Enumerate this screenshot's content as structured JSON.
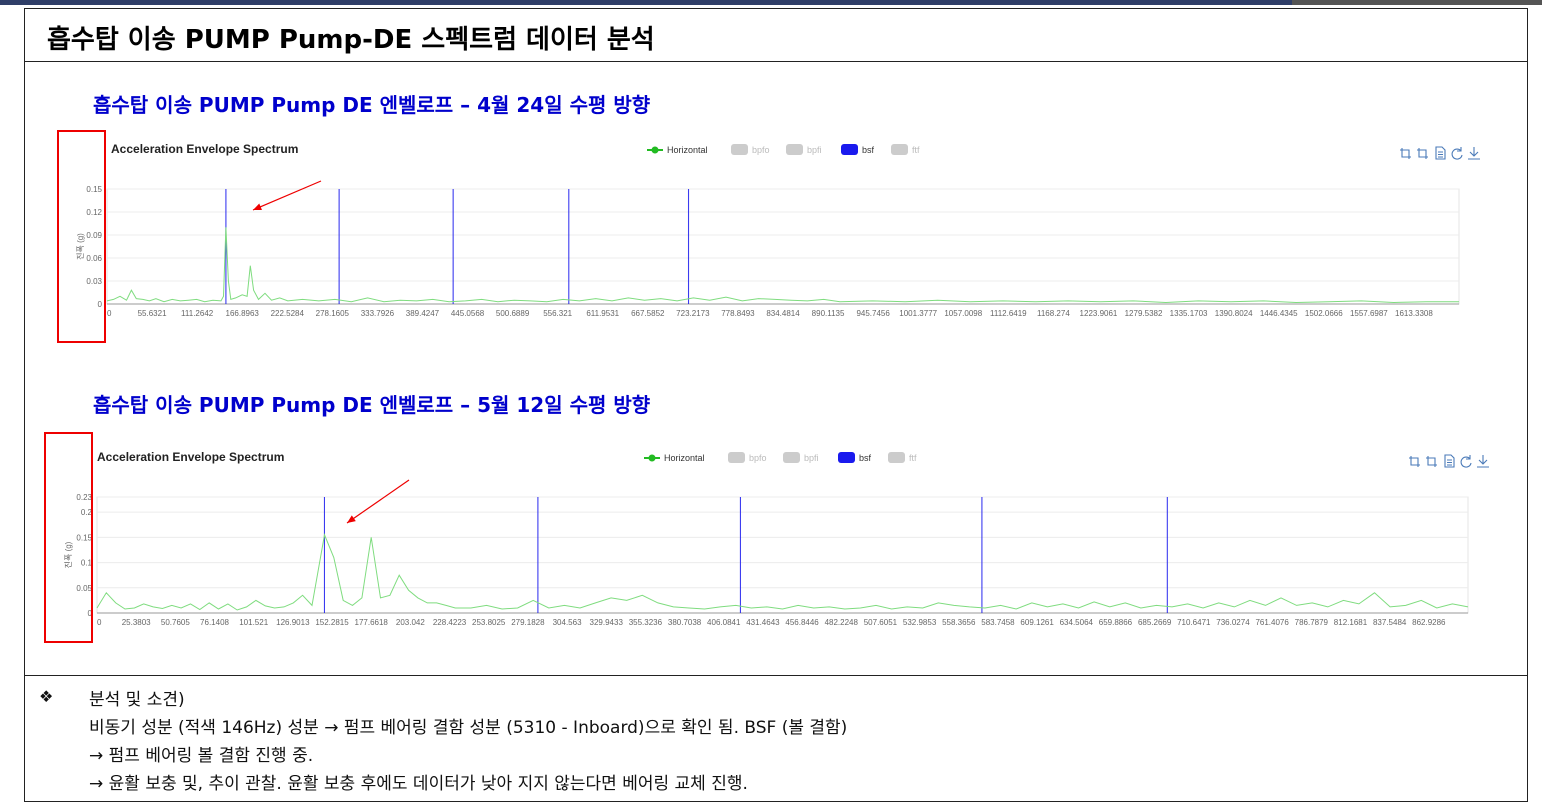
{
  "slide": {
    "title": "흡수탑 이송 PUMP Pump-DE 스펙트럼 데이터 분석"
  },
  "section1": {
    "subtitle": "흡수탑 이송 PUMP Pump DE 엔벨로프 – 4월 24일 수평 방향"
  },
  "section2": {
    "subtitle": "흡수탑 이송 PUMP Pump DE 엔벨로프 – 5월 12일 수평 방향"
  },
  "toolbar_icons": [
    "zoom-icon",
    "zoom-reset-icon",
    "data-view-icon",
    "refresh-icon",
    "download-icon"
  ],
  "colors": {
    "subtitle": "#0000cc",
    "series": "#52c41a",
    "bsf": "#1a1aee",
    "highlight_box": "#ee0000",
    "arrow": "#ee0000"
  },
  "notes": {
    "bullet": "❖",
    "heading": "분석 및 소견)",
    "lines": [
      "비동기 성분 (적색 146Hz) 성분 → 펌프 베어링 결함 성분 (5310 - Inboard)으로 확인 됨. BSF (볼 결함)",
      "→ 펌프 베어링 볼 결함 진행 중.",
      "→ 윤활 보충 및, 추이 관찰.  윤활 보충 후에도 데이터가 낮아 지지 않는다면 베어링 교체 진행."
    ]
  },
  "chart_data": [
    {
      "type": "line",
      "title": "Acceleration Envelope Spectrum",
      "ylabel": "진폭 (g)",
      "ylim": [
        0,
        0.15
      ],
      "yticks": [
        "0",
        "0.03",
        "0.06",
        "0.09",
        "0.12",
        "0.15"
      ],
      "xlim": [
        0,
        1660
      ],
      "xticks": [
        "0",
        "55.6321",
        "111.2642",
        "166.8963",
        "222.5284",
        "278.1605",
        "333.7926",
        "389.4247",
        "445.0568",
        "500.6889",
        "556.321",
        "611.9531",
        "667.5852",
        "723.2173",
        "778.8493",
        "834.4814",
        "890.1135",
        "945.7456",
        "1001.3777",
        "1057.0098",
        "1112.6419",
        "1168.274",
        "1223.9061",
        "1279.5382",
        "1335.1703",
        "1390.8024",
        "1446.4345",
        "1502.0666",
        "1557.6987",
        "1613.3308"
      ],
      "legend": [
        "Horizontal",
        "bpfo",
        "bpfi",
        "bsf",
        "ftf"
      ],
      "legend_active": [
        true,
        false,
        false,
        true,
        false
      ],
      "bsf_markers": [
        146,
        285,
        425,
        567,
        714
      ],
      "series": [
        {
          "name": "Horizontal",
          "x": [
            0,
            8,
            16,
            24,
            30,
            36,
            44,
            52,
            60,
            70,
            80,
            90,
            100,
            110,
            120,
            130,
            140,
            143,
            146,
            149,
            152,
            158,
            166,
            172,
            176,
            180,
            186,
            194,
            202,
            212,
            222,
            240,
            260,
            280,
            300,
            320,
            340,
            360,
            380,
            400,
            420,
            440,
            460,
            480,
            500,
            520,
            540,
            560,
            580,
            600,
            620,
            640,
            660,
            680,
            700,
            720,
            740,
            760,
            780,
            800,
            820,
            840,
            860,
            880,
            900,
            940,
            980,
            1020,
            1060,
            1100,
            1140,
            1180,
            1220,
            1260,
            1300,
            1340,
            1380,
            1420,
            1460,
            1500,
            1540,
            1580,
            1620,
            1660
          ],
          "y": [
            0.004,
            0.006,
            0.01,
            0.005,
            0.018,
            0.007,
            0.006,
            0.004,
            0.007,
            0.003,
            0.006,
            0.004,
            0.005,
            0.006,
            0.003,
            0.005,
            0.004,
            0.01,
            0.1,
            0.03,
            0.006,
            0.008,
            0.012,
            0.01,
            0.05,
            0.018,
            0.006,
            0.014,
            0.005,
            0.008,
            0.004,
            0.006,
            0.004,
            0.006,
            0.003,
            0.008,
            0.003,
            0.005,
            0.004,
            0.006,
            0.003,
            0.004,
            0.006,
            0.003,
            0.005,
            0.004,
            0.003,
            0.006,
            0.004,
            0.007,
            0.004,
            0.008,
            0.005,
            0.007,
            0.004,
            0.008,
            0.005,
            0.009,
            0.004,
            0.007,
            0.006,
            0.005,
            0.004,
            0.006,
            0.003,
            0.004,
            0.003,
            0.005,
            0.003,
            0.004,
            0.003,
            0.004,
            0.003,
            0.004,
            0.002,
            0.004,
            0.003,
            0.004,
            0.002,
            0.003,
            0.004,
            0.002,
            0.003,
            0.003
          ]
        }
      ]
    },
    {
      "type": "line",
      "title": "Acceleration Envelope Spectrum",
      "ylabel": "진폭 (g)",
      "ylim": [
        0,
        0.23
      ],
      "yticks": [
        "0",
        "0.05",
        "0.1",
        "0.15",
        "0.2",
        "0.23"
      ],
      "xlim": [
        0,
        880
      ],
      "xticks": [
        "0",
        "25.3803",
        "50.7605",
        "76.1408",
        "101.521",
        "126.9013",
        "152.2815",
        "177.6618",
        "203.042",
        "228.4223",
        "253.8025",
        "279.1828",
        "304.563",
        "329.9433",
        "355.3236",
        "380.7038",
        "406.0841",
        "431.4643",
        "456.8446",
        "482.2248",
        "507.6051",
        "532.9853",
        "558.3656",
        "583.7458",
        "609.1261",
        "634.5064",
        "659.8866",
        "685.2669",
        "710.6471",
        "736.0274",
        "761.4076",
        "786.7879",
        "812.1681",
        "837.5484",
        "862.9286"
      ],
      "legend": [
        "Horizontal",
        "bpfo",
        "bpfi",
        "bsf",
        "ftf"
      ],
      "legend_active": [
        true,
        false,
        false,
        true,
        false
      ],
      "bsf_markers": [
        146,
        283,
        413,
        568,
        687
      ],
      "series": [
        {
          "name": "Horizontal",
          "x": [
            0,
            6,
            12,
            18,
            24,
            30,
            36,
            42,
            48,
            54,
            60,
            66,
            72,
            78,
            84,
            90,
            96,
            102,
            108,
            114,
            120,
            126,
            132,
            138,
            146,
            152,
            158,
            164,
            170,
            176,
            182,
            188,
            194,
            200,
            206,
            212,
            218,
            224,
            230,
            240,
            250,
            260,
            270,
            280,
            290,
            300,
            310,
            320,
            330,
            340,
            350,
            360,
            370,
            380,
            390,
            400,
            410,
            420,
            430,
            440,
            450,
            460,
            470,
            480,
            490,
            500,
            510,
            520,
            530,
            540,
            550,
            560,
            570,
            580,
            590,
            600,
            610,
            620,
            630,
            640,
            650,
            660,
            670,
            680,
            690,
            700,
            710,
            720,
            730,
            740,
            750,
            760,
            770,
            780,
            790,
            800,
            810,
            820,
            830,
            840,
            850,
            860,
            870,
            880
          ],
          "y": [
            0.01,
            0.04,
            0.02,
            0.008,
            0.01,
            0.018,
            0.012,
            0.009,
            0.015,
            0.01,
            0.018,
            0.007,
            0.02,
            0.008,
            0.018,
            0.006,
            0.012,
            0.025,
            0.014,
            0.01,
            0.012,
            0.02,
            0.035,
            0.015,
            0.155,
            0.11,
            0.025,
            0.015,
            0.03,
            0.15,
            0.03,
            0.035,
            0.075,
            0.045,
            0.03,
            0.02,
            0.02,
            0.015,
            0.01,
            0.01,
            0.015,
            0.008,
            0.01,
            0.025,
            0.01,
            0.015,
            0.01,
            0.02,
            0.03,
            0.025,
            0.035,
            0.02,
            0.012,
            0.01,
            0.008,
            0.012,
            0.015,
            0.01,
            0.012,
            0.008,
            0.015,
            0.01,
            0.012,
            0.008,
            0.01,
            0.015,
            0.008,
            0.012,
            0.01,
            0.02,
            0.015,
            0.012,
            0.01,
            0.015,
            0.008,
            0.02,
            0.012,
            0.018,
            0.01,
            0.022,
            0.012,
            0.02,
            0.01,
            0.015,
            0.012,
            0.018,
            0.01,
            0.02,
            0.012,
            0.025,
            0.015,
            0.03,
            0.015,
            0.02,
            0.012,
            0.025,
            0.018,
            0.04,
            0.012,
            0.015,
            0.025,
            0.01,
            0.018,
            0.012
          ]
        }
      ]
    }
  ]
}
